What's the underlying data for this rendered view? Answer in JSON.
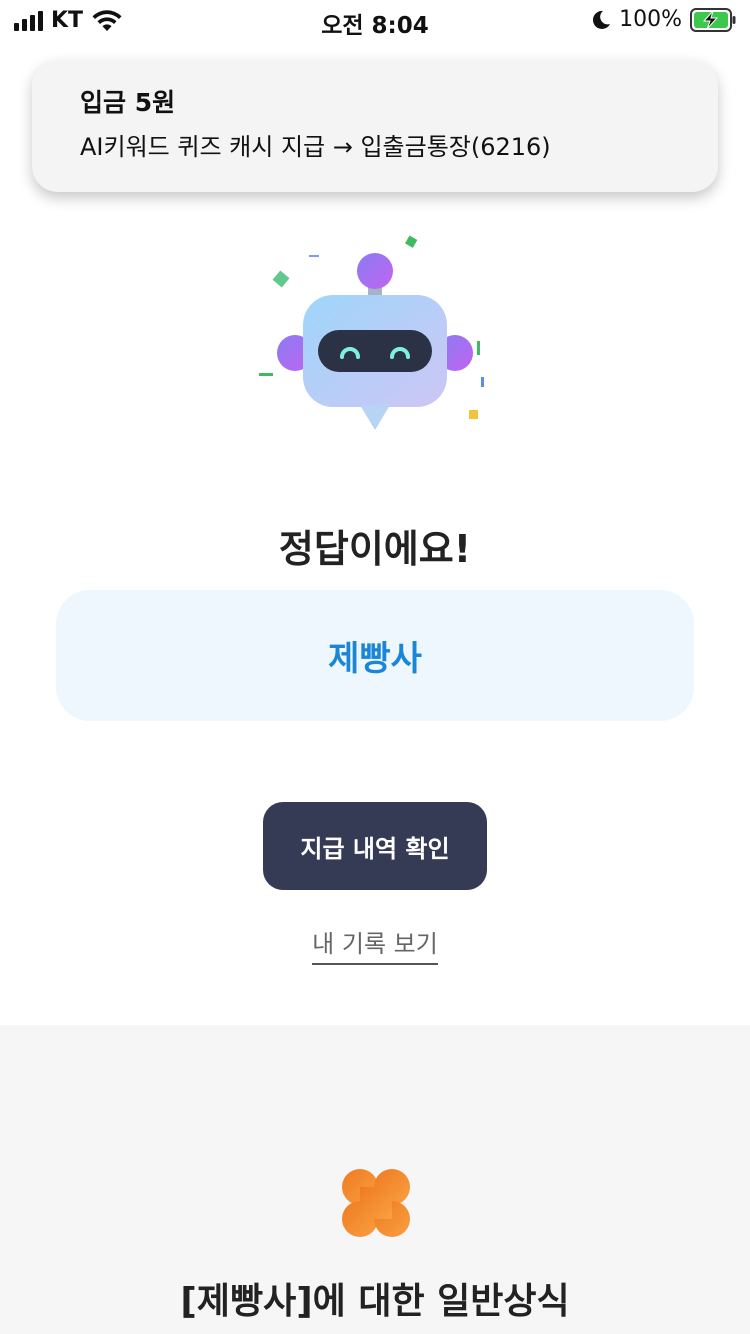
{
  "status_bar": {
    "carrier": "KT",
    "time": "오전 8:04",
    "battery": "100%"
  },
  "notification": {
    "title": "입금 5원",
    "body": "AI키워드 퀴즈 캐시 지급 → 입출금통장(6216)"
  },
  "result": {
    "title": "정답이에요!",
    "answer": "제빵사"
  },
  "actions": {
    "pay_history_button": "지급 내역 확인",
    "my_record_link": "내 기록 보기"
  },
  "info_section": {
    "title": "[제빵사]에 대한 일반상식"
  },
  "colors": {
    "answer_text": "#1a86d8",
    "answer_bg": "#eef6fe",
    "button_bg": "#353a55",
    "clover": "#f0862a"
  }
}
